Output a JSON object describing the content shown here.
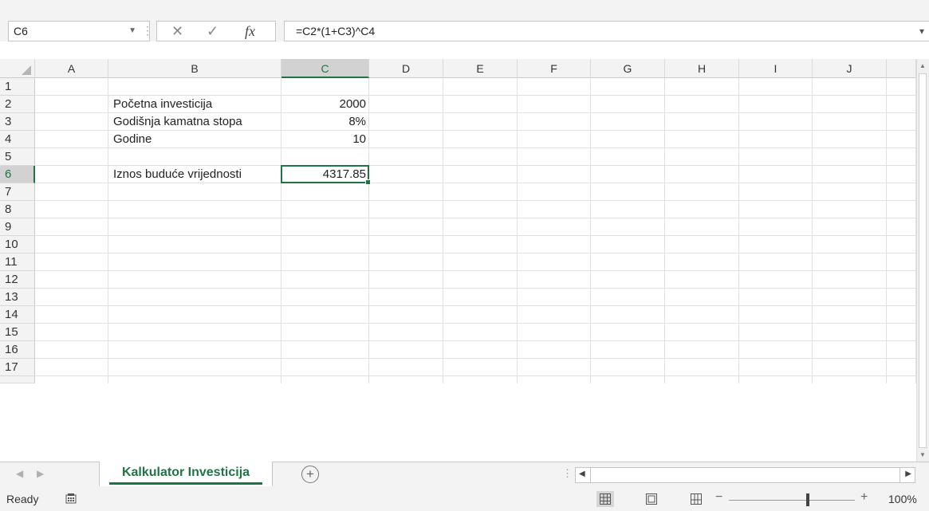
{
  "formula_bar": {
    "name_box": "C6",
    "cancel_glyph": "✕",
    "enter_glyph": "✓",
    "fx_label": "fx",
    "formula": "=C2*(1+C3)^C4"
  },
  "columns": [
    "A",
    "B",
    "C",
    "D",
    "E",
    "F",
    "G",
    "H",
    "I",
    "J"
  ],
  "selected_column": "C",
  "rows": [
    "1",
    "2",
    "3",
    "4",
    "5",
    "6",
    "7",
    "8",
    "9",
    "10",
    "11",
    "12",
    "13",
    "14",
    "15",
    "16",
    "17"
  ],
  "selected_row": "6",
  "cells": {
    "B2": "Početna investicija",
    "C2": "2000",
    "B3": "Godišnja kamatna stopa",
    "C3": "8%",
    "B4": "Godine",
    "C4": "10",
    "B6": "Iznos buduće vrijednosti",
    "C6": "4317.85"
  },
  "sheet_tabs": [
    {
      "label": "Kalkulator Investicija",
      "active": true
    }
  ],
  "add_sheet_label": "+",
  "status": {
    "ready": "Ready",
    "zoom_minus": "−",
    "zoom_plus": "+",
    "zoom": "100%",
    "zoom_level_fraction": 0.6
  },
  "colors": {
    "accent": "#217346"
  },
  "icons": [
    "name-box-dropdown-icon",
    "cancel-icon",
    "enter-icon",
    "function-icon",
    "expand-formula-icon",
    "add-sheet-icon",
    "macro-record-icon",
    "normal-view-icon",
    "page-layout-icon",
    "page-break-icon"
  ]
}
